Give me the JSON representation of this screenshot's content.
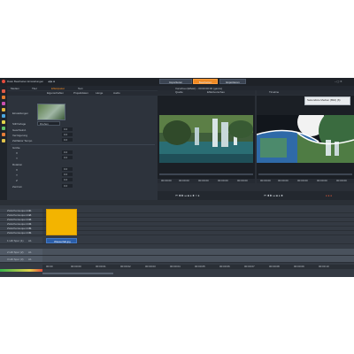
{
  "colors": {
    "accent": "#f08a24",
    "window_bg": "#2a2f37",
    "clip_yellow": "#f3b400",
    "clip_blue": "#2b5ea8"
  },
  "titlebar": {
    "app_title": "Datei  Bearbeiten  Einstellungen",
    "modes": [
      "Importieren",
      "Bearbeiten",
      "Exportieren"
    ],
    "active_mode": "Bearbeiten"
  },
  "left_panel": {
    "tabs": [
      "Medien",
      "Titel",
      "Effektpaket",
      "Text"
    ],
    "sub_tabs": [
      "Eigenschaften",
      "Projektdaten",
      "Länge",
      "Audio"
    ],
    "settings_label": "Einstellungen",
    "style_label": "Stil/Vorlage",
    "style_value": "Drehen",
    "props": [
      {
        "label": "Geschwind.",
        "value": "0.0"
      },
      {
        "label": "Verzögerung",
        "value": "0.0"
      },
      {
        "label": "Zeitfaktor Tempo",
        "value": "0.0"
      }
    ],
    "section1": "Größe",
    "sub1": [
      {
        "label": "X",
        "value": "0.0"
      },
      {
        "label": "Y",
        "value": "0.0"
      }
    ],
    "section2": "Rotation",
    "sub2": [
      {
        "label": "X",
        "value": "0.0"
      },
      {
        "label": "Y",
        "value": "0.0"
      },
      {
        "label": "Z",
        "value": "0.0"
      }
    ],
    "section3": "Zentrum",
    "sub3": [
      {
        "label": "",
        "value": "0.0"
      }
    ]
  },
  "preview": {
    "header": "Vorschau (Effekt) – 00:00:00:00 (ganze)",
    "left_tab": "Quelle",
    "left_tab2": "Effektvorschau",
    "right_tab": "Timeline",
    "timecodes_left": [
      "00:00:00",
      "00:00:00",
      "00:00:00",
      "00:00:00",
      "00:00:00"
    ],
    "timecodes_right": [
      "00:00:00",
      "00:00:00",
      "00:00:00",
      "00:00:00",
      "00:00:00"
    ],
    "tooltip": "Sekundäre Medien (Bild) (6)"
  },
  "timeline": {
    "tracks": [
      {
        "name": "Zwischensequenz 1",
        "code": "A1"
      },
      {
        "name": "Zwischensequenz 2",
        "code": "A1"
      },
      {
        "name": "Zwischensequenz 3",
        "code": "A1"
      },
      {
        "name": "Zwischensequenz 4",
        "code": "A1"
      },
      {
        "name": "Zwischensequenz 5",
        "code": "A1"
      },
      {
        "name": "Zwischensequenz 6",
        "code": "A1"
      },
      {
        "name": "1 HD Spur (1)",
        "code": "A1"
      },
      {
        "name": "2 HD Spur (2)",
        "code": "A1"
      },
      {
        "name": "3 HD Spur (3)",
        "code": "A1"
      },
      {
        "name": "4 Audio (4)",
        "code": "A1"
      }
    ],
    "clip_label": "Wasserfall.jpg",
    "ruler": [
      "00:00",
      "00:00:00",
      "00:00:01",
      "00:00:02",
      "00:00:03",
      "00:00:04",
      "00:00:05",
      "00:00:06",
      "00:00:07",
      "00:00:08",
      "00:00:09",
      "00:00:10"
    ]
  }
}
